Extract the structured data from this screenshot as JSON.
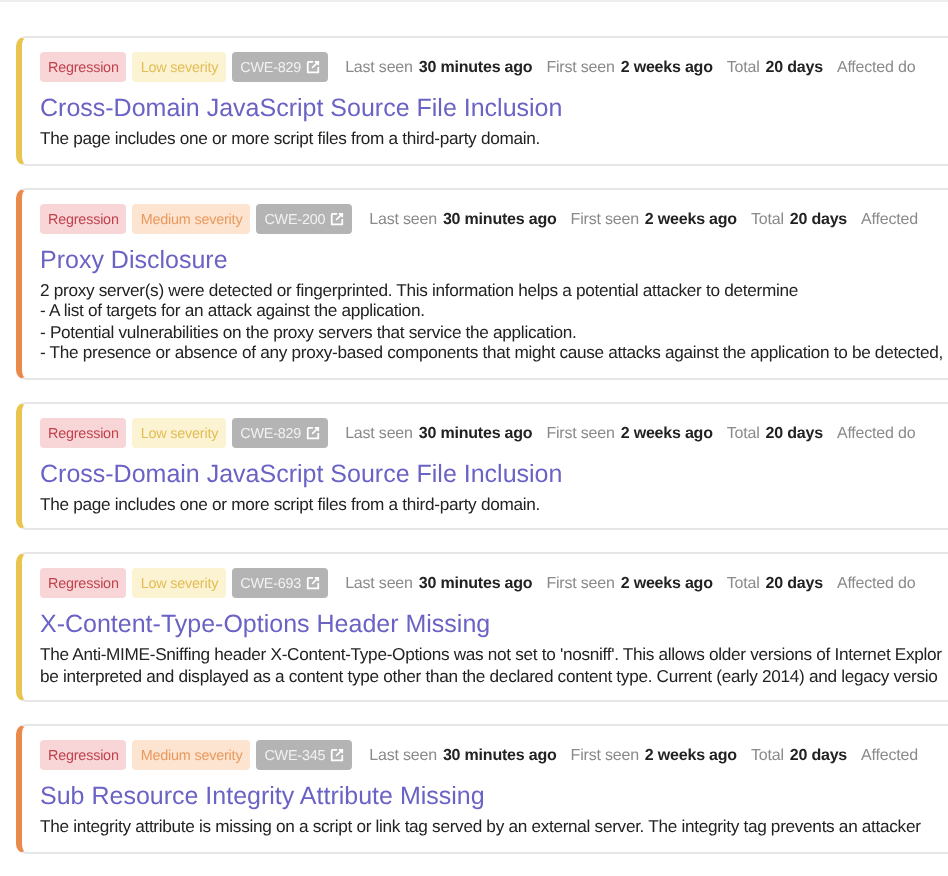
{
  "alerts": [
    {
      "severity": {
        "kind": "low",
        "label": "Low severity"
      },
      "status": "Regression",
      "cwe": "CWE-829",
      "meta": [
        {
          "label": "Last seen",
          "value": "30 minutes ago"
        },
        {
          "label": "First seen",
          "value": "2 weeks ago"
        },
        {
          "label": "Total",
          "value": "20 days"
        },
        {
          "label": "Affected do"
        }
      ],
      "title": "Cross-Domain JavaScript Source File Inclusion",
      "description": [
        "The page includes one or more script files from a third-party domain."
      ]
    },
    {
      "severity": {
        "kind": "medium",
        "label": "Medium severity"
      },
      "status": "Regression",
      "cwe": "CWE-200",
      "meta": [
        {
          "label": "Last seen",
          "value": "30 minutes ago"
        },
        {
          "label": "First seen",
          "value": "2 weeks ago"
        },
        {
          "label": "Total",
          "value": "20 days"
        },
        {
          "label": "Affected"
        }
      ],
      "title": "Proxy Disclosure",
      "description": [
        "2 proxy server(s) were detected or fingerprinted. This information helps a potential attacker to determine",
        "- A list of targets for an attack against the application.",
        "- Potential vulnerabilities on the proxy servers that service the application.",
        "- The presence or absence of any proxy-based components that might cause attacks against the application to be detected,"
      ]
    },
    {
      "severity": {
        "kind": "low",
        "label": "Low severity"
      },
      "status": "Regression",
      "cwe": "CWE-829",
      "meta": [
        {
          "label": "Last seen",
          "value": "30 minutes ago"
        },
        {
          "label": "First seen",
          "value": "2 weeks ago"
        },
        {
          "label": "Total",
          "value": "20 days"
        },
        {
          "label": "Affected do"
        }
      ],
      "title": "Cross-Domain JavaScript Source File Inclusion",
      "description": [
        "The page includes one or more script files from a third-party domain."
      ]
    },
    {
      "severity": {
        "kind": "low",
        "label": "Low severity"
      },
      "status": "Regression",
      "cwe": "CWE-693",
      "meta": [
        {
          "label": "Last seen",
          "value": "30 minutes ago"
        },
        {
          "label": "First seen",
          "value": "2 weeks ago"
        },
        {
          "label": "Total",
          "value": "20 days"
        },
        {
          "label": "Affected do"
        }
      ],
      "title": "X-Content-Type-Options Header Missing",
      "description": [
        "The Anti-MIME-Sniffing header X-Content-Type-Options was not set to 'nosniff'. This allows older versions of Internet Explor",
        "be interpreted and displayed as a content type other than the declared content type. Current (early 2014) and legacy versio"
      ]
    },
    {
      "severity": {
        "kind": "medium",
        "label": "Medium severity"
      },
      "status": "Regression",
      "cwe": "CWE-345",
      "meta": [
        {
          "label": "Last seen",
          "value": "30 minutes ago"
        },
        {
          "label": "First seen",
          "value": "2 weeks ago"
        },
        {
          "label": "Total",
          "value": "20 days"
        },
        {
          "label": "Affected"
        }
      ],
      "title": "Sub Resource Integrity Attribute Missing",
      "description": [
        "The integrity attribute is missing on a script or link tag served by an external server. The integrity tag prevents an attacker"
      ]
    }
  ]
}
